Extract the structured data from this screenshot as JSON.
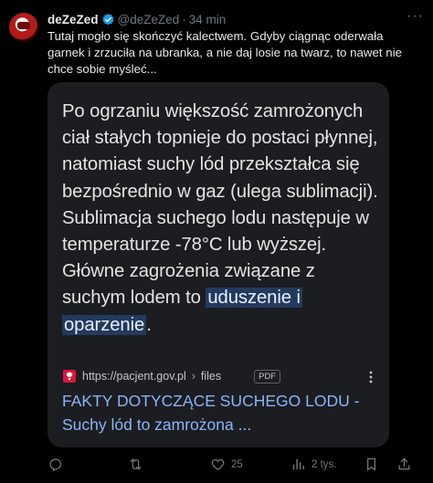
{
  "author": {
    "display_name": "deZeZed",
    "handle": "@deZeZed",
    "separator": "·",
    "time": "34 min"
  },
  "tweet": {
    "text": "Tutaj mogło się skończyć kalectwem. Gdyby ciągnąc oderwała garnek i zrzuciła na ubranka, a nie daj losie na twarz, to nawet nie chce sobie myśleć..."
  },
  "card": {
    "snippet_main": "Po ogrzaniu większość zamrożonych ciał stałych topnieje do postaci płynnej, natomiast suchy lód przekształca się bezpośrednio w gaz (ulega sublimacji). Sublimacja suchego lodu następuje w temperaturze -78°C lub wyższej. Główne zagrożenia związane z suchym lodem to ",
    "snippet_highlight_1": "uduszenie i",
    "snippet_highlight_2": "oparzenie",
    "snippet_end": ".",
    "source_url": "https://pacjent.gov.pl",
    "source_separator": "›",
    "source_path": "files",
    "file_badge": "PDF",
    "link_title": "FAKTY DOTYCZĄCE SUCHEGO LODU - Suchy lód to zamrożona ..."
  },
  "actions": {
    "reply_count": "",
    "retweet_count": "",
    "like_count": "25",
    "views_count": "2 tys."
  },
  "colors": {
    "background": "#000000",
    "verified": "#1d9bf0",
    "link": "#8ab4f8",
    "highlight_bg": "#233a5e",
    "muted": "#71767b"
  },
  "icons": {
    "avatar": "avatar-image",
    "verified": "verified-badge-icon",
    "more": "more-icon",
    "source": "polish-eagle-icon",
    "kebab": "kebab-menu-icon",
    "reply": "reply-icon",
    "retweet": "retweet-icon",
    "like": "heart-icon",
    "views": "views-icon",
    "bookmark": "bookmark-icon",
    "share": "share-icon"
  }
}
